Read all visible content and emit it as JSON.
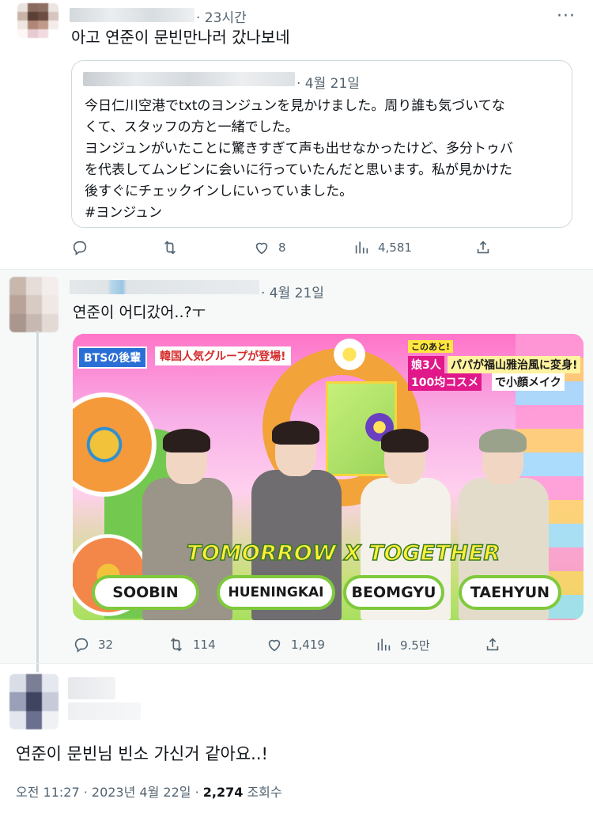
{
  "tweet1": {
    "time": "· 23시간",
    "more_label": "···",
    "text": "아고 연준이 문빈만나러 갔나보네",
    "quote": {
      "date": "· 4월 21일",
      "lines": [
        "今日仁川空港でtxtのヨンジュンを見かけました。周り誰も気づいてな",
        "くて、スタッフの方と一緒でした。",
        "ヨンジュンがいたことに驚きすぎて声も出せなかったけど、多分トゥバ",
        "を代表してムンビンに会いに行っていたんだと思います。私が見かけた",
        "後すぐにチェックインしにいっていました。",
        "#ヨンジュン"
      ]
    },
    "actions": {
      "reply": "",
      "retweet": "",
      "like": "8",
      "views": "4,581"
    }
  },
  "tweet2": {
    "time": "· 4월 21일",
    "text": "연준이 어디갔어..?ㅜ",
    "media": {
      "badge_left_1": "BTSの後輩",
      "badge_left_2": "韓国人気グループが登場!",
      "badge_top_small": "このあと!",
      "badge_right_1": "娘3人",
      "badge_right_2": "パパが福山雅治風に変身!",
      "badge_right_3": "100均コスメ",
      "badge_right_4": "で小顔メイク",
      "group_name": "TOMORROW X TOGETHER",
      "names": [
        "SOOBIN",
        "HUENINGKAI",
        "BEOMGYU",
        "TAEHYUN"
      ]
    },
    "actions": {
      "reply": "32",
      "retweet": "114",
      "like": "1,419",
      "views": "9.5만"
    }
  },
  "tweet3": {
    "text": "연준이 문빈님 빈소 가신거 같아요..!",
    "footer_time": "오전 11:27 · 2023년 4월 22일 · ",
    "footer_views_count": "2,274",
    "footer_views_label": " 조회수"
  },
  "colors": {
    "muted": "#536471",
    "border": "#cfd9de",
    "accent_green": "#7fc93c"
  },
  "icons": [
    "reply-icon",
    "retweet-icon",
    "like-icon",
    "views-icon",
    "share-icon",
    "more-icon"
  ]
}
